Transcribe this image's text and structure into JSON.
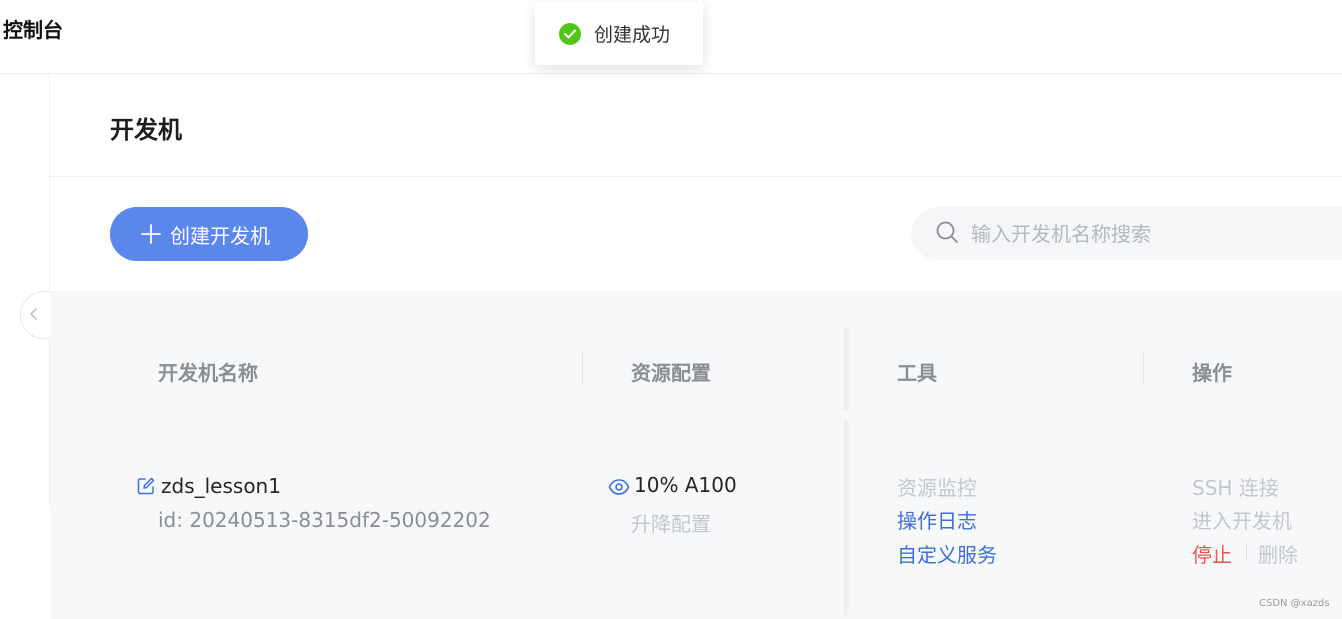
{
  "app": {
    "title": "控制台"
  },
  "toast": {
    "message": "创建成功",
    "icon": "check-circle-icon",
    "color": "#52c41a"
  },
  "page": {
    "title": "开发机"
  },
  "toolbar": {
    "create_label": "创建开发机",
    "search_placeholder": "输入开发机名称搜索",
    "accent": "#5b86ec"
  },
  "table": {
    "columns": [
      "开发机名称",
      "资源配置",
      "工具",
      "操作"
    ],
    "rows": [
      {
        "name": "zds_lesson1",
        "id": "id: 20240513-8315df2-50092202",
        "resource": "10% A100",
        "resource_action": "升降配置",
        "tools": {
          "monitor": "资源监控",
          "logs": "操作日志",
          "custom_service": "自定义服务"
        },
        "actions": {
          "ssh": "SSH 连接",
          "enter": "进入开发机",
          "stop": "停止",
          "delete": "删除"
        }
      }
    ]
  },
  "watermark": "CSDN @xazds"
}
